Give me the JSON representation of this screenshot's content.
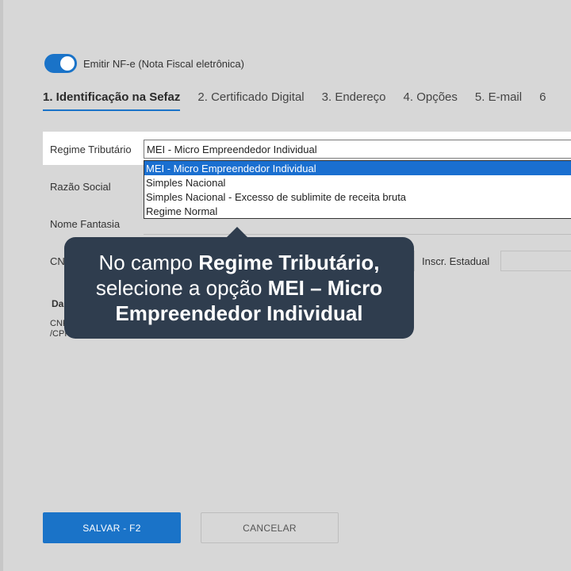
{
  "toggle": {
    "label": "Emitir NF-e (Nota Fiscal eletrônica)",
    "checked": true
  },
  "tabs": [
    {
      "label": "1. Identificação na Sefaz",
      "active": true
    },
    {
      "label": "2. Certificado Digital"
    },
    {
      "label": "3. Endereço"
    },
    {
      "label": "4. Opções"
    },
    {
      "label": "5. E-mail"
    },
    {
      "label": "6"
    }
  ],
  "form": {
    "regime_label": "Regime Tributário",
    "regime_value": "MEI - Micro Empreendedor Individual",
    "regime_options": [
      "MEI - Micro Empreendedor Individual",
      "Simples Nacional",
      "Simples Nacional - Excesso de sublimite de receita bruta",
      "Regime Normal"
    ],
    "razao_label": "Razão Social",
    "fantasia_label": "Nome Fantasia",
    "cnpj_label_partial": "CN",
    "inscr_label": "Inscr. Estadual",
    "section_partial": "Da",
    "cnpj_small_1": "CNP",
    "cnpj_small_2": "/CPF"
  },
  "tooltip": {
    "line1_normal": "No campo ",
    "line1_bold": "Regime Tributário,",
    "line2_normal": "selecione a opção ",
    "line2_bold": "MEI – Micro",
    "line3_bold": "Empreendedor Individual"
  },
  "buttons": {
    "save": "SALVAR - F2",
    "cancel": "CANCELAR"
  },
  "colors": {
    "accent": "#1a73c8",
    "tooltip_bg": "#2f3d4e",
    "background": "#d7d7d7"
  }
}
